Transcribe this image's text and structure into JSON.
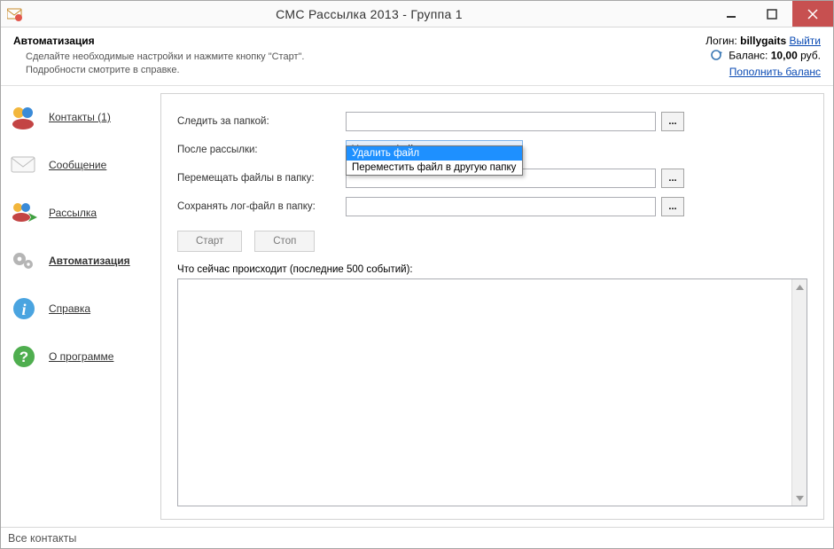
{
  "window": {
    "title": "СМС Рассылка 2013 - Группа 1"
  },
  "info": {
    "title": "Автоматизация",
    "desc_line1": "Сделайте необходимые настройки и нажмите кнопку \"Старт\".",
    "desc_line2": "Подробности смотрите в справке.",
    "login_label": "Логин:",
    "login_value": "billygaits",
    "logout_link": "Выйти",
    "balance_label": "Баланс:",
    "balance_value": "10,00",
    "balance_unit": "руб.",
    "topup_link": "Пополнить баланс"
  },
  "sidebar": {
    "items": [
      {
        "label": "Контакты (1)"
      },
      {
        "label": "Сообщение"
      },
      {
        "label": "Рассылка"
      },
      {
        "label": "Автоматизация"
      },
      {
        "label": "Справка"
      },
      {
        "label": "О программе"
      }
    ]
  },
  "form": {
    "watch_label": "Следить за папкой:",
    "after_label": "После рассылки:",
    "after_value": "Удалить файл",
    "after_options": [
      "Удалить файл",
      "Переместить файл в другую папку"
    ],
    "move_label": "Перемещать файлы в папку:",
    "log_label": "Сохранять лог-файл в папку:",
    "browse": "...",
    "start": "Старт",
    "stop": "Стоп",
    "events_label": "Что сейчас происходит (последние 500 событий):"
  },
  "statusbar": {
    "text": "Все контакты"
  }
}
